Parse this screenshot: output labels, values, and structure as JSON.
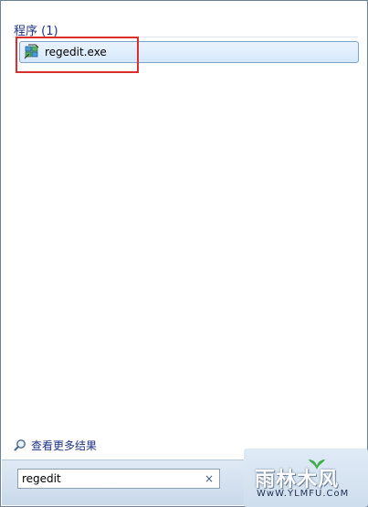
{
  "start_menu": {
    "section": {
      "title": "程序 (1)"
    },
    "results": [
      {
        "label": "regedit.exe",
        "icon": "regedit-icon"
      }
    ],
    "see_more": {
      "label": "查看更多结果",
      "icon": "search-icon"
    },
    "search": {
      "value": "regedit",
      "clear_glyph": "×"
    },
    "highlight_color": "#d9302f"
  },
  "watermark": {
    "title": "雨林木风",
    "url": "WwW.YLMFU.CoM"
  }
}
